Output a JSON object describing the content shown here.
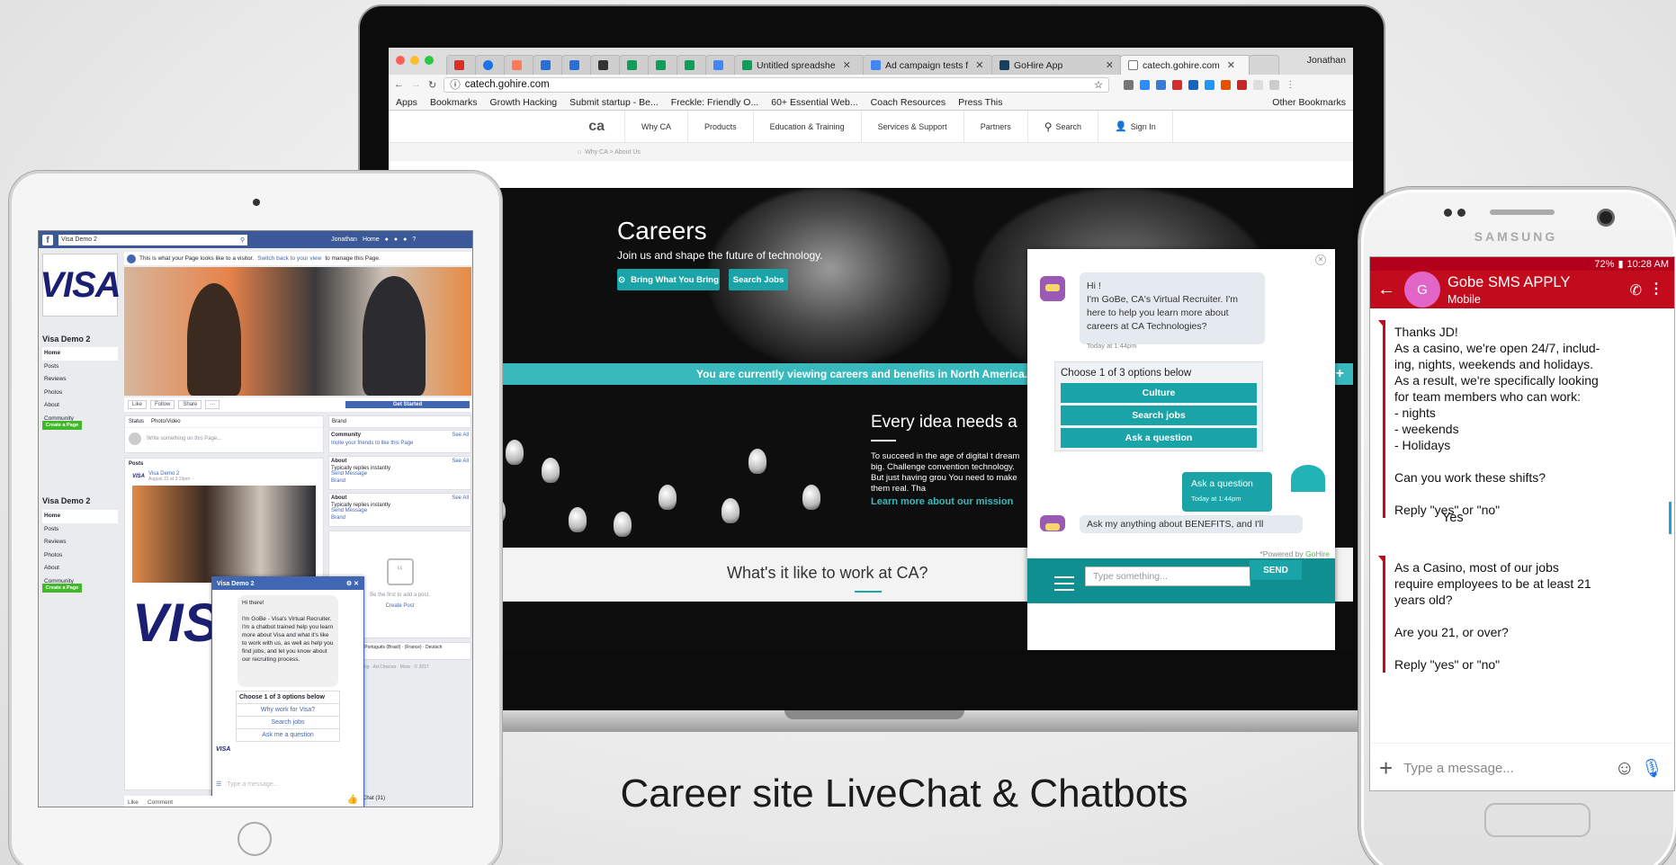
{
  "caption": "Career site LiveChat & Chatbots",
  "laptop": {
    "tabs": [
      {
        "label": "Untitled spreadshe",
        "icon": "sheets-icon"
      },
      {
        "label": "Ad campaign tests f",
        "icon": "doc-icon"
      },
      {
        "label": "GoHire App",
        "icon": "gohire-icon"
      },
      {
        "label": "catech.gohire.com",
        "icon": "page-icon"
      }
    ],
    "tab_user": "Jonathan",
    "url": "catech.gohire.com",
    "bookmarks": [
      "Apps",
      "Bookmarks",
      "Growth Hacking",
      "Submit startup - Be...",
      "Freckle: Friendly O...",
      "60+ Essential Web...",
      "Coach Resources",
      "Press This"
    ],
    "other_bookmarks": "Other Bookmarks",
    "site_nav": [
      "Why CA",
      "Products",
      "Education & Training",
      "Services & Support",
      "Partners",
      "Search",
      "Sign In"
    ],
    "logo": "ca",
    "breadcrumb": "Why CA  >  About Us",
    "careers_title": "Careers",
    "careers_sub": "Join us and shape the future of technology.",
    "btn_bring": "Bring What You Bring",
    "btn_search_jobs": "Search Jobs",
    "banner": "You are currently viewing careers and benefits in North America.",
    "idea_title": "Every idea needs a",
    "idea_text": "To succeed in the age of digital t dream big. Challenge convention technology. But just having grou You need to make them real. Tha",
    "idea_link": "Learn more about our mission",
    "work_title": "What's it like to work at CA?",
    "chat": {
      "greeting": "Hi !\nI'm GoBe, CA's Virtual Recruiter. I'm here to help you learn more about careers at CA Technologies?",
      "greeting_time": "Today at 1:44pm",
      "options_title": "Choose 1 of 3 options below",
      "options": [
        "Culture",
        "Search jobs",
        "Ask a question"
      ],
      "user_msg": "Ask a question",
      "user_time": "Today at 1:44pm",
      "followup": "Ask my anything about BENEFITS, and I'll",
      "powered_prefix": "*Powered by",
      "powered_brand": "GoHire",
      "input_placeholder": "Type something...",
      "send": "SEND"
    }
  },
  "tablet": {
    "search": "Visa Demo 2",
    "top_user": "Jonathan",
    "top_home": "Home",
    "visa_logo": "VISA",
    "page_name": "Visa Demo 2",
    "nav": [
      "Home",
      "Posts",
      "Reviews",
      "Photos",
      "About",
      "Community"
    ],
    "create_page": "Create a Page",
    "notice_text": "This is what your Page looks like to a visitor.",
    "notice_link": "Switch back to your view",
    "notice_tail": "to manage this Page.",
    "actions": [
      "Like",
      "Follow",
      "Share",
      "···"
    ],
    "get_started": "Get Started",
    "status_tab": "Status",
    "photo_tab": "Photo/Video",
    "write_something": "Write something on this Page...",
    "posts_label": "Posts",
    "post_author": "Visa Demo 2",
    "post_date": "August 31 at 3:19pm · ",
    "brand_label": "Brand",
    "community_label": "Community",
    "see_all": "See All",
    "invite": "Invite your friends to like this Page",
    "about_label": "About",
    "replies": "Typically replies instantly",
    "send_message": "Send Message",
    "be_first": "Be the first to add a post.",
    "create_post": "Create Post",
    "lang": "(US) · Español · Português (Brasil) · (France) · Deutsch",
    "footer": "· Terms · Advertising · Ad Choices · More · © 2017",
    "chat_label": "Chat (31)",
    "bottom_like": "Like",
    "bottom_comment": "Comment",
    "msg": {
      "title": "Visa Demo 2",
      "bubble": "Hi there!\n\nI'm GoBe - Visa's Virtual Recruiter. I'm a chatbot trained help you learn more about Visa and what it's like to work with us, as well as help you find jobs, and let you know about our recruiting process.",
      "options_title": "Choose 1 of 3 options below",
      "options": [
        "Why work for Visa?",
        "Search jobs",
        "Ask me a question"
      ],
      "placeholder": "Type a message..."
    }
  },
  "phone": {
    "brand": "SAMSUNG",
    "battery": "72%",
    "time": "10:28 AM",
    "contact_initial": "G",
    "contact_name": "Gobe SMS APPLY",
    "contact_sub": "Mobile",
    "msg1": "Thanks  JD!\nAs a casino, we're open 24/7, includ-\ning, nights, weekends and holidays.\nAs a result, we're specifically looking\nfor team members who can work:\n- nights\n- weekends\n- Holidays\n\nCan you work these shifts?\n\nReply  \"yes\" or \"no\"",
    "reply1": "Yes",
    "msg2": "As a Casino, most of our jobs\nrequire employees to be at least 21\nyears old?\n\nAre you 21, or over?\n\nReply \"yes\" or \"no\"",
    "compose_placeholder": "Type a message..."
  }
}
